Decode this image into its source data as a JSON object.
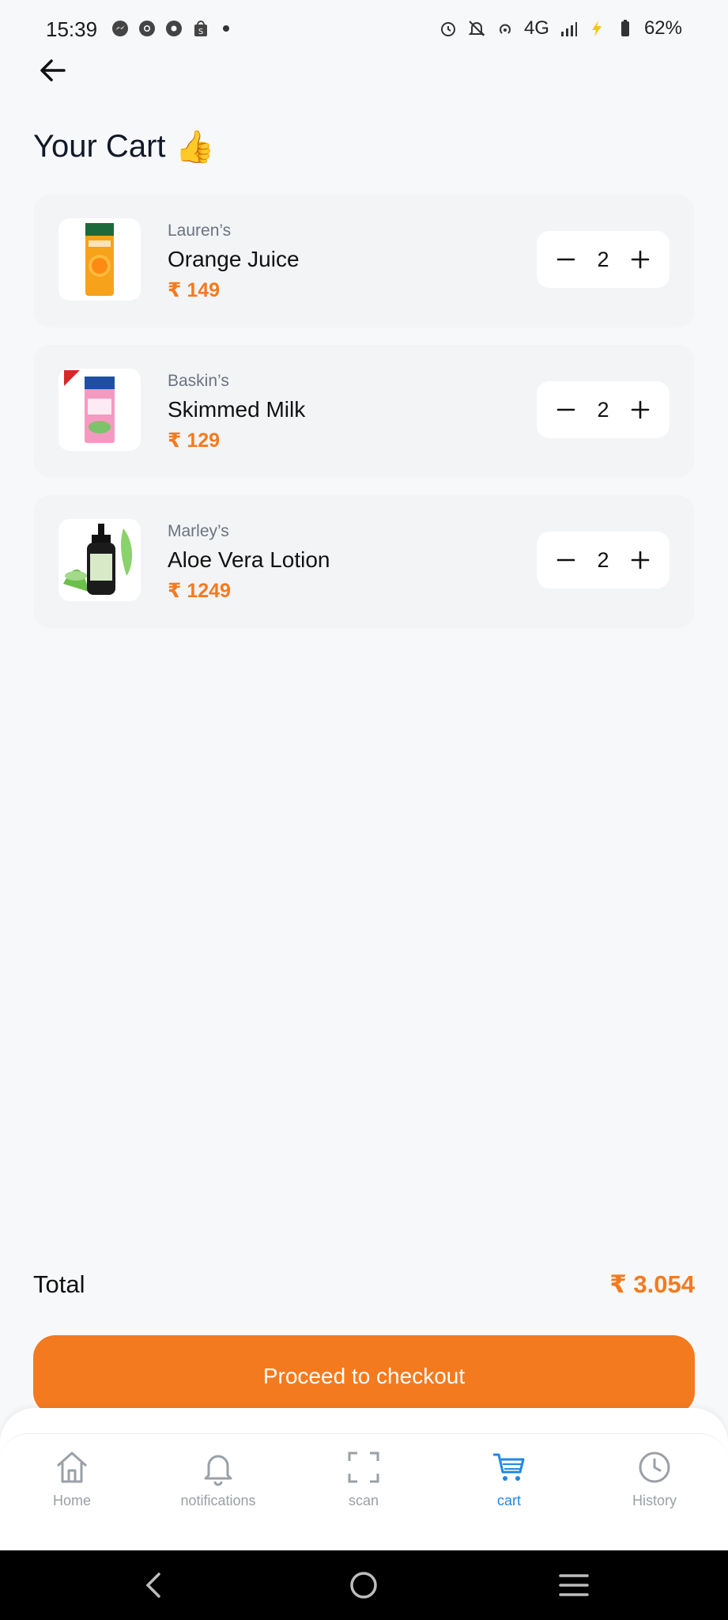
{
  "status_bar": {
    "time": "15:39",
    "network": "4G",
    "battery": "62%",
    "left_icons": [
      "messenger-icon",
      "chrome-icon",
      "settings-icon",
      "shop-icon"
    ],
    "right_icons": [
      "alarm-icon",
      "bell-off-icon",
      "hotspot-icon",
      "signal-icon",
      "charging-icon",
      "battery-icon"
    ]
  },
  "header": {
    "title": "Your Cart",
    "title_emoji": "👍"
  },
  "cart": {
    "items": [
      {
        "brand": "Lauren’s",
        "name": "Orange Juice",
        "price": "₹ 149",
        "qty": "2",
        "image": "juice-carton"
      },
      {
        "brand": "Baskin’s",
        "name": "Skimmed Milk",
        "price": "₹ 129",
        "qty": "2",
        "image": "milk-carton"
      },
      {
        "brand": "Marley’s",
        "name": "Aloe Vera Lotion",
        "price": "₹ 1249",
        "qty": "2",
        "image": "lotion-bottle"
      }
    ]
  },
  "summary": {
    "total_label": "Total",
    "total_value": "₹ 3.054"
  },
  "checkout": {
    "label": "Proceed to checkout"
  },
  "bottom_nav": {
    "items": [
      {
        "label": "Home",
        "icon": "home-icon",
        "active": false
      },
      {
        "label": "notifications",
        "icon": "bell-icon",
        "active": false
      },
      {
        "label": "scan",
        "icon": "scan-icon",
        "active": false
      },
      {
        "label": "cart",
        "icon": "cart-icon",
        "active": true
      },
      {
        "label": "History",
        "icon": "clock-icon",
        "active": false
      }
    ]
  },
  "colors": {
    "accent": "#f47a1f",
    "active_nav": "#1e88e5",
    "background": "#f7f8fa",
    "card": "#f3f4f6"
  }
}
